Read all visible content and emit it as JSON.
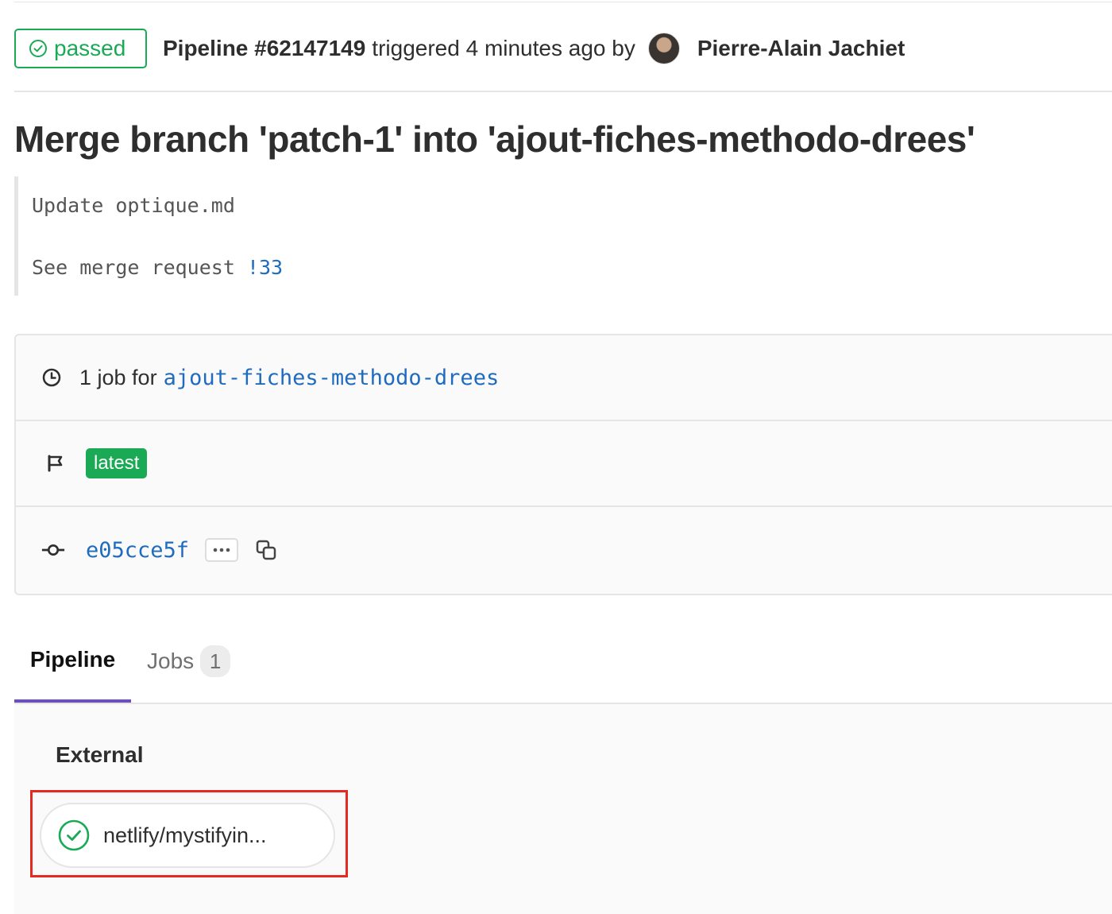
{
  "header": {
    "status": "passed",
    "pipeline_label": "Pipeline #62147149",
    "triggered_text": "triggered 4 minutes ago by",
    "author": "Pierre-Alain Jachiet"
  },
  "commit": {
    "title": "Merge branch 'patch-1' into 'ajout-fiches-methodo-drees'",
    "description_line1": "Update optique.md",
    "description_line2_prefix": "See merge request",
    "merge_request_link": "!33"
  },
  "info": {
    "jobs_text": "1 job for",
    "branch": "ajout-fiches-methodo-drees",
    "tag": "latest",
    "sha": "e05cce5f"
  },
  "tabs": [
    {
      "label": "Pipeline"
    },
    {
      "label": "Jobs",
      "count": "1"
    }
  ],
  "graph": {
    "stage": "External",
    "job": "netlify/mystifyin..."
  },
  "colors": {
    "success": "#1aaa55",
    "link": "#1f6bbf",
    "tab_active": "#6b4fbb",
    "highlight": "#e52a22"
  }
}
